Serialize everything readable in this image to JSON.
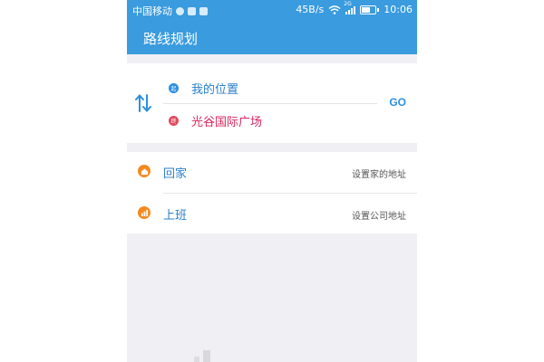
{
  "status_bar": {
    "carrier": "中国移动",
    "network_speed": "45B/s",
    "signal_type": "2G",
    "time": "10:06"
  },
  "header": {
    "title": "路线规划"
  },
  "route": {
    "from": {
      "label": "我的位置",
      "badge": "起",
      "color": "#2a8fe0"
    },
    "to": {
      "label": "光谷国际广场",
      "badge": "终",
      "color": "#e04a5c"
    },
    "go_label": "GO"
  },
  "shortcuts": [
    {
      "title": "回家",
      "hint": "设置家的地址",
      "icon": "home-icon"
    },
    {
      "title": "上班",
      "hint": "设置公司地址",
      "icon": "briefcase-icon"
    }
  ],
  "colors": {
    "primary": "#3a9bde",
    "accent_orange": "#f5891f",
    "destination": "#d6275e",
    "background": "#efeff4"
  }
}
